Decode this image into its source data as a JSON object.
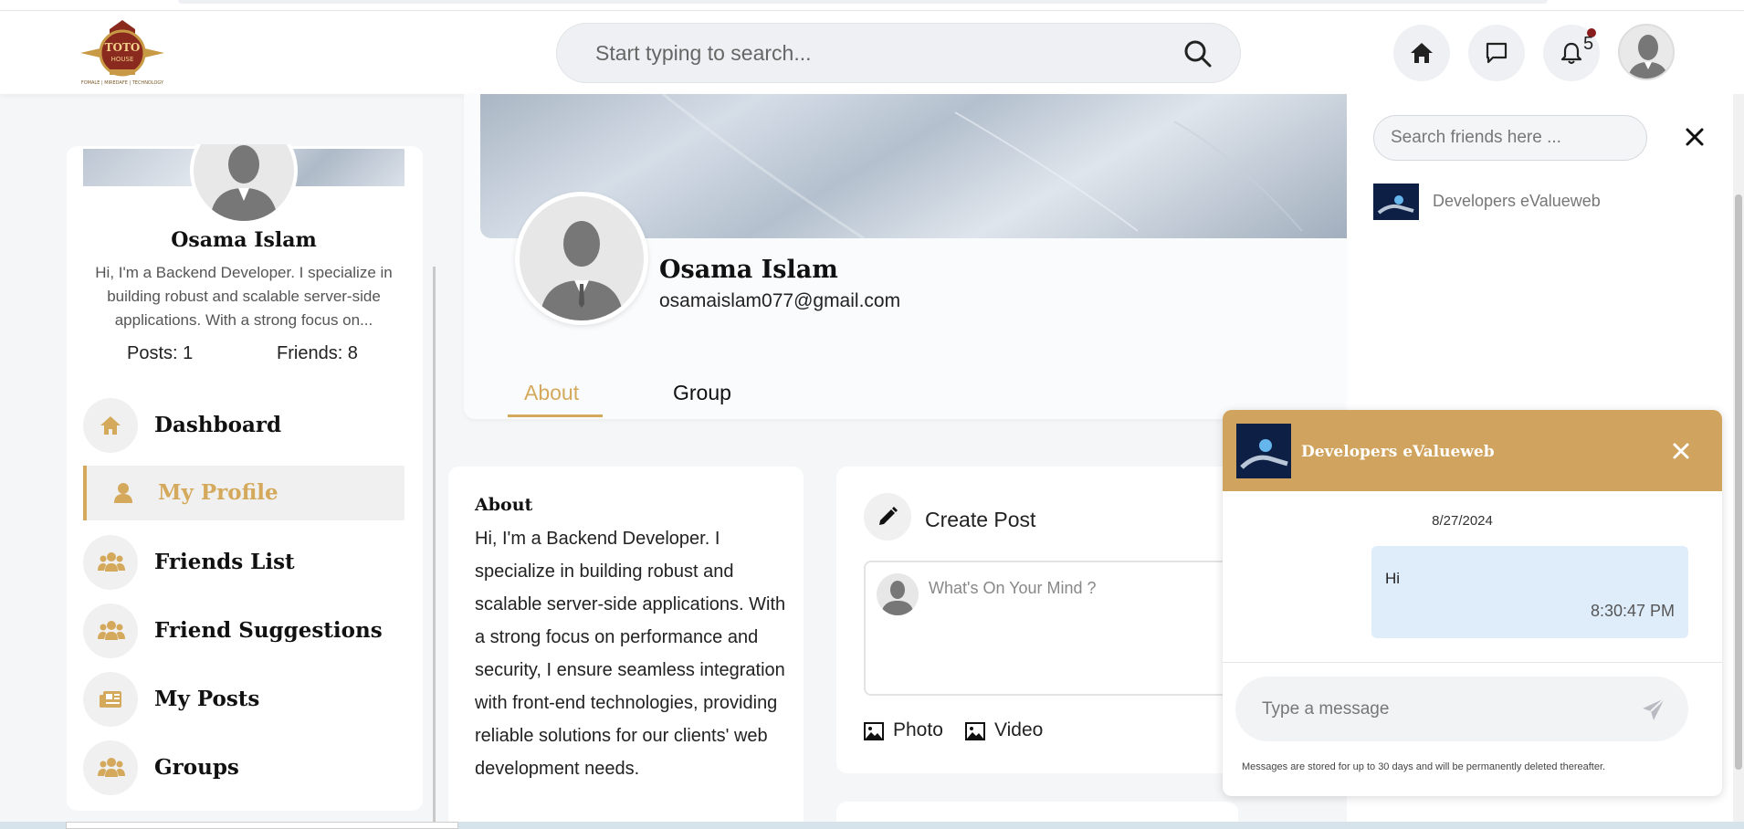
{
  "header": {
    "logo_text": "TOTO HOUSE",
    "logo_tagline": "FOMALE | MIREDAFE | TECHNOLOGY",
    "search_placeholder": "Start typing to search...",
    "notification_count": "5"
  },
  "sidebar": {
    "user_name": "Osama Islam",
    "user_bio": "Hi, I'm a Backend Developer. I specialize in building robust and scalable server-side applications. With a strong focus on...",
    "posts_label": "Posts: 1",
    "friends_label": "Friends: 8",
    "items": [
      {
        "label": "Dashboard",
        "icon": "home-icon",
        "active": false
      },
      {
        "label": "My Profile",
        "icon": "user-icon",
        "active": true
      },
      {
        "label": "Friends List",
        "icon": "users-icon",
        "active": false
      },
      {
        "label": "Friend Suggestions",
        "icon": "users-icon",
        "active": false
      },
      {
        "label": "My Posts",
        "icon": "newspaper-icon",
        "active": false
      },
      {
        "label": "Groups",
        "icon": "users-icon",
        "active": false
      }
    ]
  },
  "profile": {
    "name": "Osama Islam",
    "email": "osamaislam077@gmail.com",
    "tabs": [
      "About",
      "Group"
    ],
    "active_tab": "About"
  },
  "about": {
    "title": "About",
    "text": "Hi, I'm a Backend Developer. I specialize in building robust and scalable server-side applications. With a strong focus on performance and security, I ensure seamless integration with front-end technologies, providing reliable solutions for our clients' web development needs."
  },
  "create_post": {
    "title": "Create Post",
    "placeholder": "What's On Your Mind ?",
    "photo_label": "Photo",
    "video_label": "Video"
  },
  "friends_panel": {
    "search_placeholder": "Search friends here ...",
    "friends": [
      {
        "name": "Developers eValueweb"
      }
    ]
  },
  "chat": {
    "title": "Developers eValueweb",
    "date": "8/27/2024",
    "messages": [
      {
        "text": "Hi",
        "time": "8:30:47 PM"
      }
    ],
    "input_placeholder": "Type a message",
    "note": "Messages are stored for up to 30 days and will be permanently deleted thereafter."
  },
  "colors": {
    "accent": "#d4a95c",
    "chat_header": "#d0a45e",
    "bubble": "#dfedfb"
  }
}
